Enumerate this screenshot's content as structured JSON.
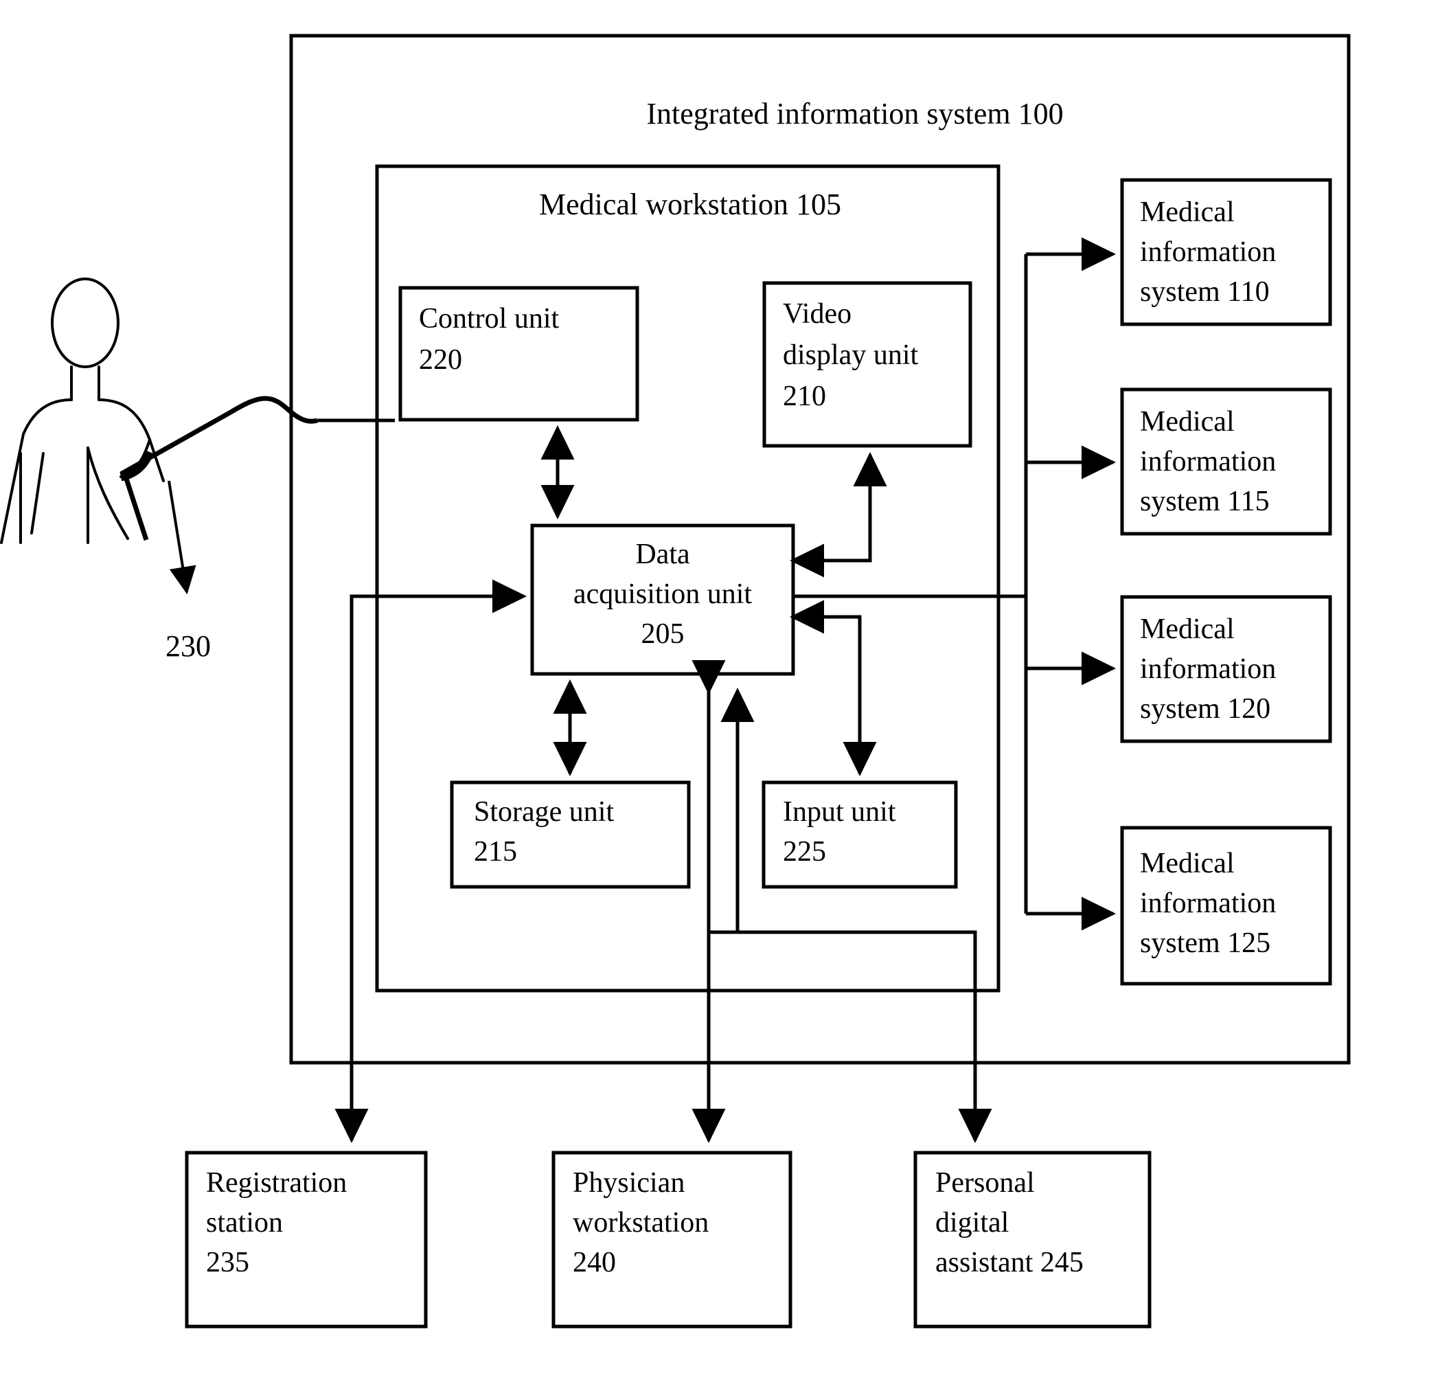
{
  "figure": {
    "outer_container": {
      "label": "Integrated information system 100"
    },
    "workstation_container": {
      "label": "Medical workstation 105"
    },
    "patient": {
      "reference_label": "230"
    },
    "workstation_units": [
      {
        "id": "control-unit",
        "line1": "Control unit",
        "line2": "220",
        "line3": ""
      },
      {
        "id": "video-display-unit",
        "line1": "Video",
        "line2": "display unit",
        "line3": "210"
      },
      {
        "id": "data-acquisition-unit",
        "line1": "Data",
        "line2": "acquisition unit",
        "line3": "205"
      },
      {
        "id": "storage-unit",
        "line1": "Storage unit",
        "line2": "215",
        "line3": ""
      },
      {
        "id": "input-unit",
        "line1": "Input unit",
        "line2": "225",
        "line3": ""
      }
    ],
    "medical_information_systems": [
      {
        "id": "mis-110",
        "line1": "Medical",
        "line2": "information",
        "line3": "system 110"
      },
      {
        "id": "mis-115",
        "line1": "Medical",
        "line2": "information",
        "line3": "system 115"
      },
      {
        "id": "mis-120",
        "line1": "Medical",
        "line2": "information",
        "line3": "system 120"
      },
      {
        "id": "mis-125",
        "line1": "Medical",
        "line2": "information",
        "line3": "system 125"
      }
    ],
    "external_stations": [
      {
        "id": "registration-station",
        "line1": "Registration",
        "line2": "station",
        "line3": "235"
      },
      {
        "id": "physician-workstation",
        "line1": "Physician",
        "line2": "workstation",
        "line3": "240"
      },
      {
        "id": "personal-digital-assistant",
        "line1": "Personal",
        "line2": "digital",
        "line3": "assistant 245"
      }
    ],
    "colors": {
      "stroke": "#000000",
      "background": "#ffffff"
    }
  }
}
